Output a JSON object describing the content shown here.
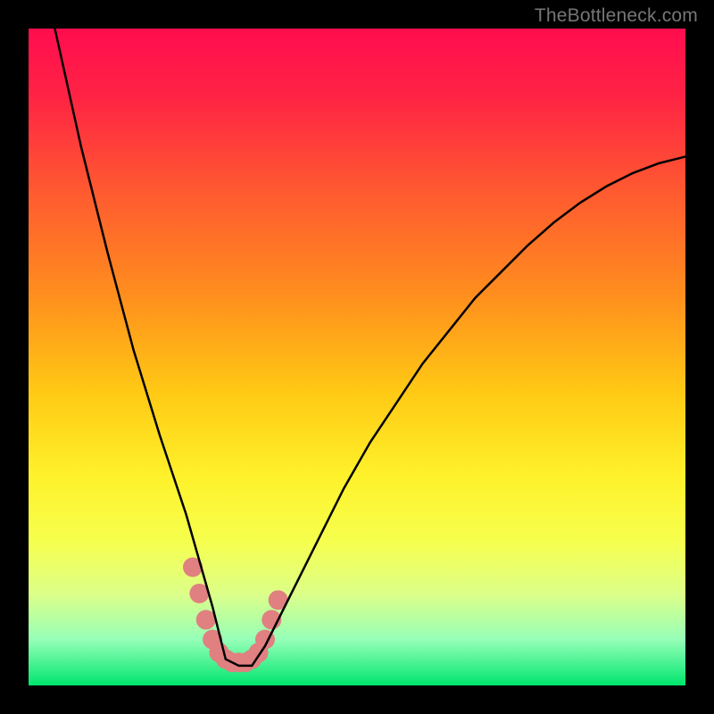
{
  "watermark": "TheBottleneck.com",
  "chart_data": {
    "type": "line",
    "title": "",
    "xlabel": "",
    "ylabel": "",
    "xlim": [
      0,
      100
    ],
    "ylim": [
      0,
      100
    ],
    "grid": false,
    "series": [
      {
        "name": "bottleneck-curve",
        "description": "V-shaped bottleneck curve, minimum near x≈30, rising on both sides",
        "x": [
          4,
          8,
          12,
          16,
          20,
          24,
          28,
          30,
          32,
          34,
          36,
          40,
          44,
          48,
          52,
          56,
          60,
          64,
          68,
          72,
          76,
          80,
          84,
          88,
          92,
          96,
          100
        ],
        "values": [
          100,
          82,
          66,
          51,
          38,
          26,
          12,
          4,
          3,
          3,
          6,
          14,
          22,
          30,
          37,
          43,
          49,
          54,
          59,
          63,
          67,
          70.5,
          73.5,
          76,
          78,
          79.5,
          80.5
        ]
      }
    ],
    "background_gradient": {
      "type": "vertical",
      "stops": [
        {
          "offset": 0.0,
          "color": "#ff0d4f"
        },
        {
          "offset": 0.1,
          "color": "#ff2244"
        },
        {
          "offset": 0.25,
          "color": "#ff5a30"
        },
        {
          "offset": 0.4,
          "color": "#ff8c1e"
        },
        {
          "offset": 0.55,
          "color": "#ffc814"
        },
        {
          "offset": 0.68,
          "color": "#fff12a"
        },
        {
          "offset": 0.78,
          "color": "#f6ff4d"
        },
        {
          "offset": 0.86,
          "color": "#ddff88"
        },
        {
          "offset": 0.93,
          "color": "#96ffb8"
        },
        {
          "offset": 1.0,
          "color": "#00e66e"
        }
      ]
    },
    "highlight": {
      "description": "pink bead-like markers near curve minimum",
      "color": "#e08080",
      "points": [
        {
          "x": 25,
          "y": 18
        },
        {
          "x": 26,
          "y": 14
        },
        {
          "x": 27,
          "y": 10
        },
        {
          "x": 28,
          "y": 7
        },
        {
          "x": 29,
          "y": 5
        },
        {
          "x": 30,
          "y": 4
        },
        {
          "x": 31,
          "y": 3.5
        },
        {
          "x": 32,
          "y": 3.5
        },
        {
          "x": 33,
          "y": 3.5
        },
        {
          "x": 34,
          "y": 4
        },
        {
          "x": 35,
          "y": 5
        },
        {
          "x": 36,
          "y": 7
        },
        {
          "x": 37,
          "y": 10
        },
        {
          "x": 38,
          "y": 13
        }
      ]
    }
  }
}
